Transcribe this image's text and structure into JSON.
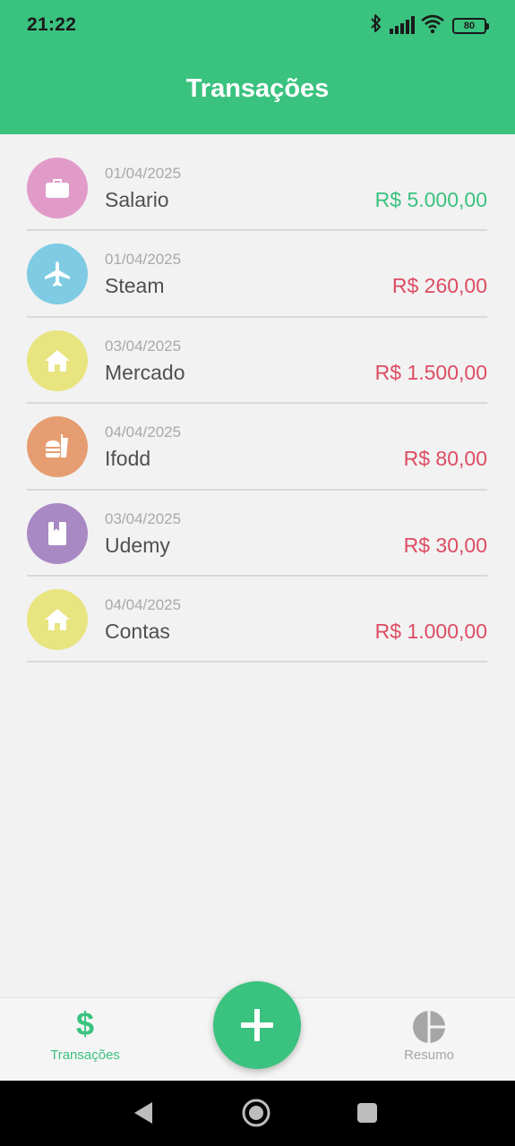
{
  "status_bar": {
    "time": "21:22",
    "battery": "80",
    "icons": [
      "bluetooth-icon",
      "signal-icon",
      "wifi-icon",
      "battery-icon"
    ]
  },
  "header": {
    "title": "Transações"
  },
  "colors": {
    "primary": "#3ac27f",
    "income": "#3ac27f",
    "expense": "#dd4c63"
  },
  "transactions": [
    {
      "date": "01/04/2025",
      "name": "Salario",
      "amount": "R$ 5.000,00",
      "type": "income",
      "icon": "briefcase-icon",
      "icon_color": "#e19bc9"
    },
    {
      "date": "01/04/2025",
      "name": "Steam",
      "amount": "R$ 260,00",
      "type": "expense",
      "icon": "airplane-icon",
      "icon_color": "#7ecbe3"
    },
    {
      "date": "03/04/2025",
      "name": "Mercado",
      "amount": "R$ 1.500,00",
      "type": "expense",
      "icon": "home-icon",
      "icon_color": "#e8e47f"
    },
    {
      "date": "04/04/2025",
      "name": "Ifodd",
      "amount": "R$ 80,00",
      "type": "expense",
      "icon": "fastfood-icon",
      "icon_color": "#e69d71"
    },
    {
      "date": "03/04/2025",
      "name": "Udemy",
      "amount": "R$ 30,00",
      "type": "expense",
      "icon": "book-icon",
      "icon_color": "#a989c4"
    },
    {
      "date": "04/04/2025",
      "name": "Contas",
      "amount": "R$ 1.000,00",
      "type": "expense",
      "icon": "home-icon",
      "icon_color": "#e8e47f"
    }
  ],
  "bottom_nav": {
    "transacoes_label": "Transações",
    "resumo_label": "Resumo",
    "active_color": "#3ac27f",
    "inactive_color": "#a6a6a6",
    "add_button_icon": "plus-icon"
  }
}
